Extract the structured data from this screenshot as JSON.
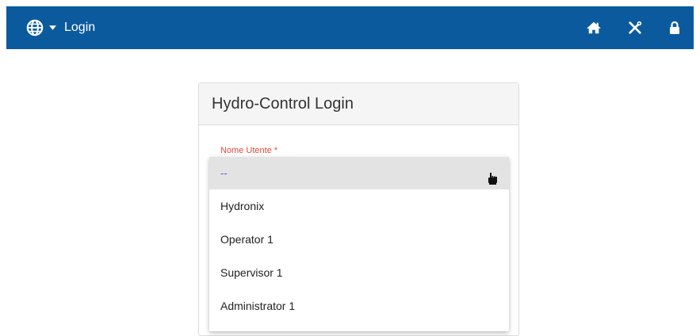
{
  "navbar": {
    "title": "Login",
    "icons": [
      "globe-icon",
      "caret-down-icon",
      "home-icon",
      "tools-icon",
      "lock-icon"
    ],
    "background": "#0b5a9e"
  },
  "panel": {
    "title": "Hydro-Control Login"
  },
  "username_field": {
    "label": "Nome Utente *",
    "label_color": "#e04a3a",
    "selected_value": "--",
    "options": [
      "--",
      "Hydronix",
      "Operator 1",
      "Supervisor 1",
      "Administrator 1"
    ]
  }
}
